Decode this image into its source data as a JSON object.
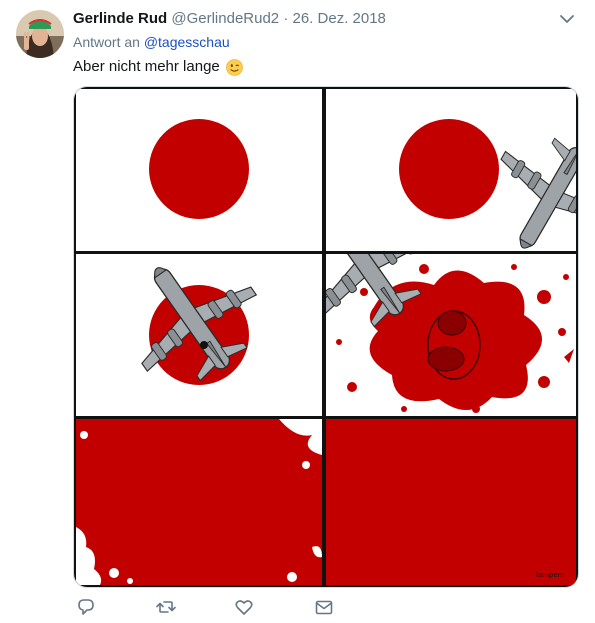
{
  "author": {
    "name": "Gerlinde Rud",
    "handle": "@GerlindeRud2",
    "separator": "·",
    "date": "26. Dez. 2018"
  },
  "reply": {
    "prefix": "Antwort an",
    "mention": "@tagesschau"
  },
  "tweet": {
    "text": "Aber nicht mehr lange",
    "emoji": "winking-face-emoji"
  },
  "media": {
    "signature": "lampem",
    "colors": {
      "red": "#c30000",
      "plane": "#9a9fa3",
      "border": "#1a1a1a"
    }
  },
  "actions": {
    "icons": [
      "reply-icon",
      "retweet-icon",
      "like-icon",
      "direct-message-icon"
    ],
    "color": "#657786"
  },
  "header_icon": "chevron-down-icon"
}
